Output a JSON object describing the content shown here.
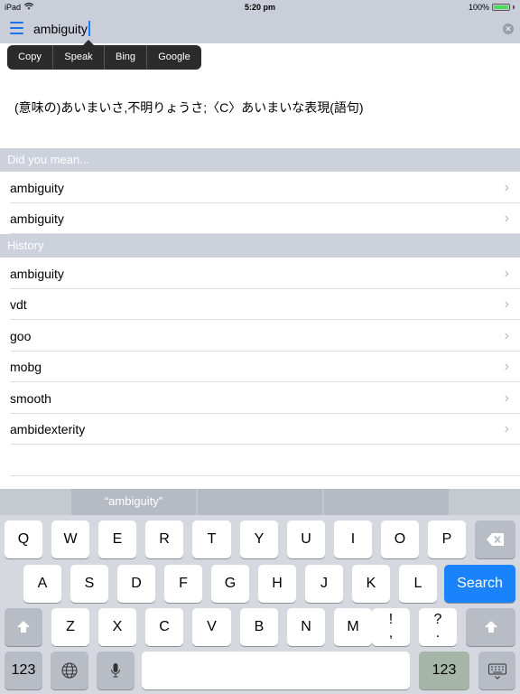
{
  "status_bar": {
    "device": "iPad",
    "time": "5:20 pm",
    "battery_percent": "100%",
    "battery_level": 1.0
  },
  "search": {
    "query": "ambiguity"
  },
  "popover_menu": {
    "items": [
      "Copy",
      "Speak",
      "Bing",
      "Google"
    ]
  },
  "definition": {
    "text": "(意味の)あいまいさ,不明りょうさ;〈C〉あいまいな表現(語句)"
  },
  "did_you_mean": {
    "header": "Did you mean...",
    "items": [
      "ambiguity",
      "ambiguity"
    ]
  },
  "history": {
    "header": "History",
    "items": [
      "ambiguity",
      "vdt",
      "goo",
      "mobg",
      "smooth",
      "ambidexterity"
    ]
  },
  "keyboard": {
    "suggestion": "“ambiguity”",
    "row1": [
      "Q",
      "W",
      "E",
      "R",
      "T",
      "Y",
      "U",
      "I",
      "O",
      "P"
    ],
    "row2": [
      "A",
      "S",
      "D",
      "F",
      "G",
      "H",
      "J",
      "K",
      "L"
    ],
    "row3": [
      "Z",
      "X",
      "C",
      "V",
      "B",
      "N",
      "M"
    ],
    "punct1_top": "!",
    "punct1_bottom": ",",
    "punct2_top": "?",
    "punct2_bottom": ".",
    "search_label": "Search",
    "numbers_label": "123"
  },
  "colors": {
    "accent": "#1a82fb",
    "section_header": "#ccd1db",
    "toolbar": "#c9ced9"
  }
}
